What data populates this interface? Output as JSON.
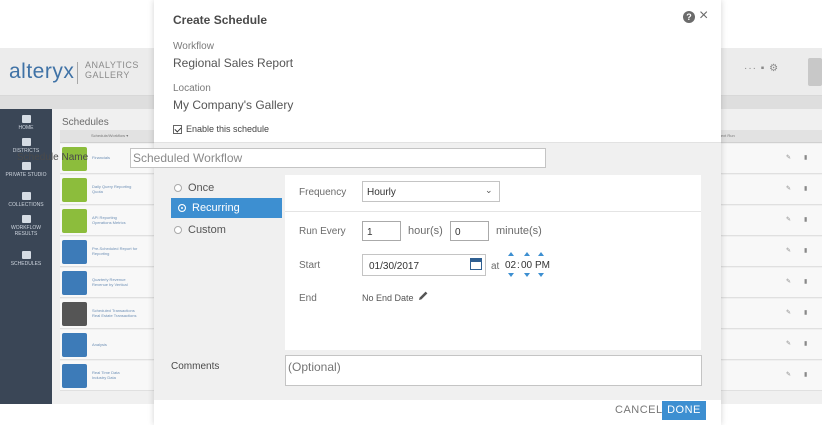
{
  "background_app": {
    "logo": "alteryx",
    "logo_sub_line1": "ANALYTICS",
    "logo_sub_line2": "GALLERY",
    "top_right": "··· ▪ ⚙",
    "page_title": "Schedules",
    "column_header": "Schedule/Workflow ▾",
    "column_header_right": "Next Run",
    "nav": [
      {
        "label": "HOME",
        "icon": "home-icon"
      },
      {
        "label": "DISTRICTS",
        "icon": "districts-icon"
      },
      {
        "label": "PRIVATE STUDIO",
        "icon": "studio-icon"
      },
      {
        "label": "COLLECTIONS",
        "icon": "collections-icon"
      },
      {
        "label": "WORKFLOW RESULTS",
        "icon": "workflow-results-icon"
      },
      {
        "label": "SCHEDULES",
        "icon": "schedules-icon"
      }
    ],
    "rows": [
      {
        "title": "Financials",
        "sub": "",
        "thumb": "#8cbd3c"
      },
      {
        "title": "Daily Query Reporting",
        "sub": "Quota",
        "thumb": "#8cbd3c"
      },
      {
        "title": "API Reporting",
        "sub": "Operations Metrics",
        "thumb": "#8cbd3c"
      },
      {
        "title": "Pre-Scheduled Report for",
        "sub": "Reporting",
        "thumb": "#3d7bb8"
      },
      {
        "title": "Quarterly Revenue",
        "sub": "Revenue by Vertical",
        "thumb": "#3d7bb8"
      },
      {
        "title": "Scheduled Transactions",
        "sub": "Real Estate Transactions",
        "thumb": "#555555"
      },
      {
        "title": "Analysis",
        "sub": "",
        "thumb": "#3d7bb8"
      },
      {
        "title": "Real Time Data",
        "sub": "Industry Data",
        "thumb": "#3d7bb8"
      }
    ]
  },
  "modal": {
    "title": "Create Schedule",
    "help_icon": "?",
    "close_icon": "×",
    "workflow_label": "Workflow",
    "workflow_value": "Regional Sales Report",
    "location_label": "Location",
    "location_value": "My Company's Gallery",
    "enable_label": "Enable this schedule",
    "enable_checked": true,
    "schedule_name_label": "Schedule Name",
    "schedule_name_value": "Scheduled Workflow",
    "radio_options": [
      "Once",
      "Recurring",
      "Custom"
    ],
    "selected_option": "Recurring",
    "frequency_label": "Frequency",
    "frequency_value": "Hourly",
    "run_every_label": "Run Every",
    "run_every_hours": "1",
    "hours_unit": "hour(s)",
    "run_every_minutes": "0",
    "minutes_unit": "minute(s)",
    "start_label": "Start",
    "start_date": "01/30/2017",
    "at_label": "at",
    "start_hours": "02",
    "start_minutes": "00",
    "start_ampm": "PM",
    "end_label": "End",
    "end_value": "No End Date",
    "comments_label": "Comments",
    "comments_placeholder": "(Optional)",
    "cancel_label": "CANCEL",
    "done_label": "DONE"
  },
  "colors": {
    "accent": "#3d8fd1",
    "sidebar": "#3a4656",
    "logo": "#3f72a6"
  }
}
